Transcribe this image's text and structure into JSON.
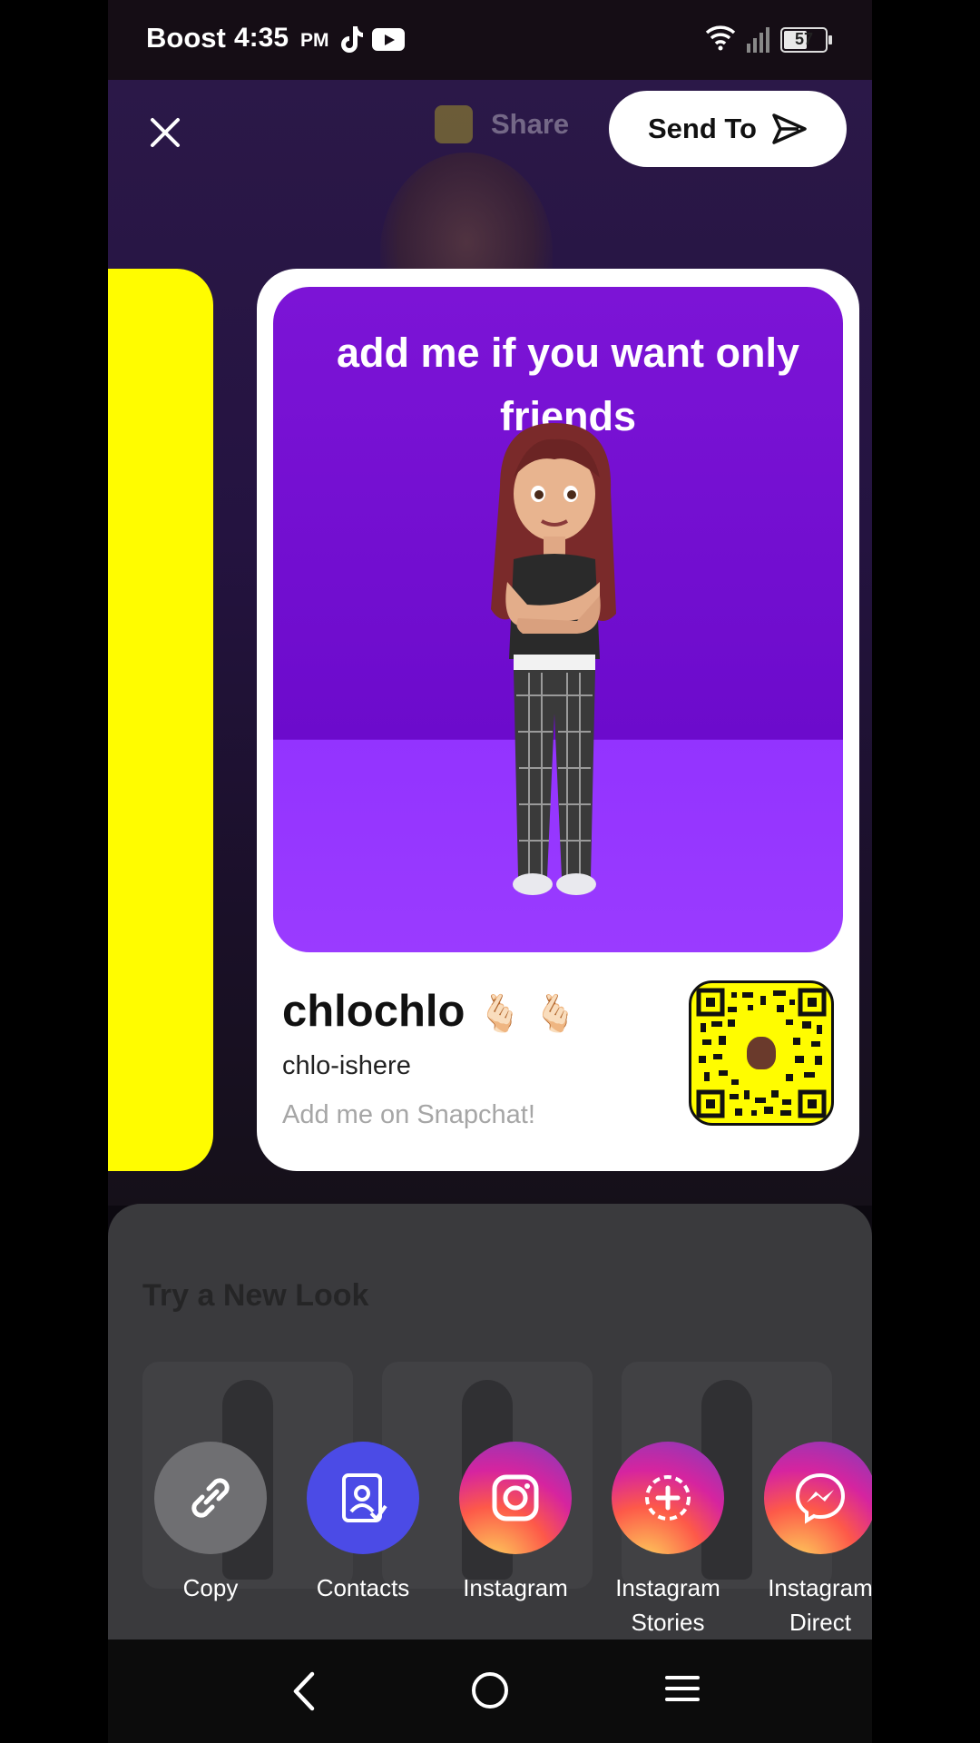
{
  "status_bar": {
    "carrier": "Boost",
    "time": "4:35",
    "ampm": "PM",
    "battery": "57",
    "icons": [
      "tiktok-icon",
      "youtube-icon",
      "wifi-icon",
      "signal-icon",
      "battery-icon"
    ]
  },
  "header": {
    "close_icon": "close-icon",
    "share_label": "Share",
    "send_to_label": "Send To"
  },
  "profile_card": {
    "caption": "add me if you want only friends",
    "display_name": "chlochlo",
    "emoji": "🫰🏻 🫰🏻",
    "username": "chlo-ishere",
    "tagline": "Add me on Snapchat!"
  },
  "pager": {
    "count": 2,
    "active_index": 1
  },
  "sheet": {
    "title": "Try a New Look"
  },
  "share_actions": [
    {
      "label": "Copy",
      "icon": "link-icon"
    },
    {
      "label": "Contacts",
      "icon": "contacts-icon"
    },
    {
      "label": "Instagram",
      "icon": "instagram-icon"
    },
    {
      "label": "Instagram Stories",
      "icon": "instagram-stories-icon"
    },
    {
      "label": "Instagram Direct",
      "icon": "messenger-icon"
    }
  ],
  "colors": {
    "snap_yellow": "#fffc00",
    "card_purple": "#7c14d6",
    "contacts_blue": "#4b4be6"
  },
  "nav_bar": [
    "back-icon",
    "home-icon",
    "recents-icon"
  ]
}
